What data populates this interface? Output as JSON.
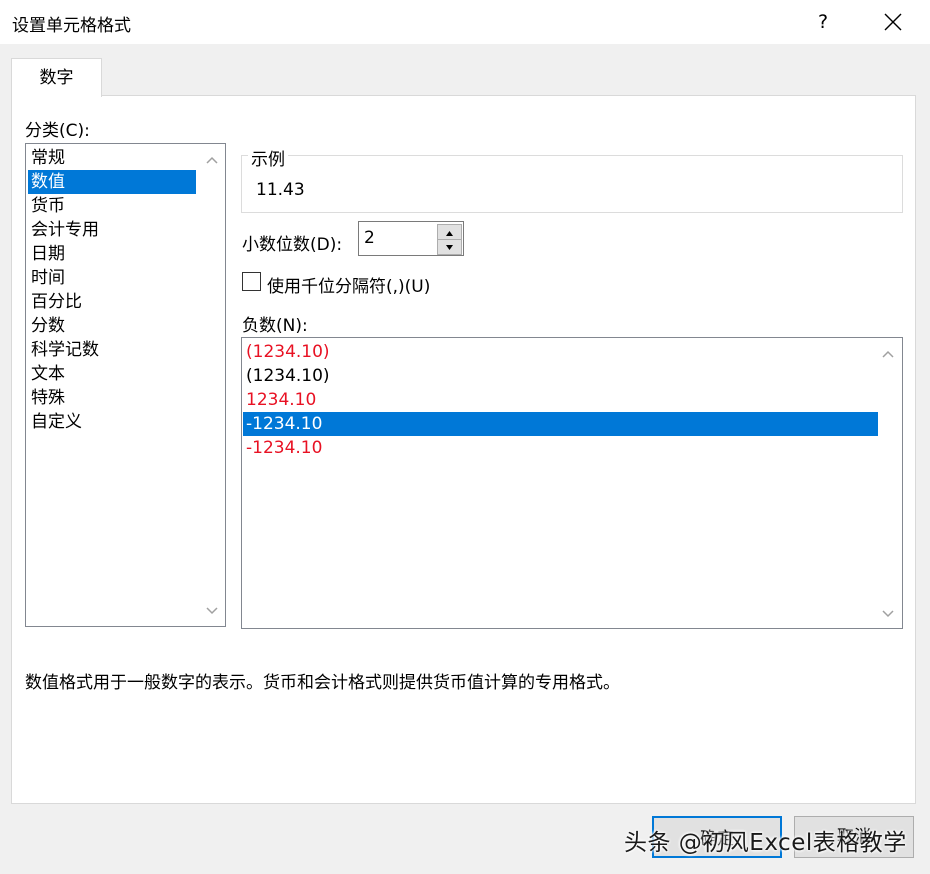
{
  "window": {
    "title": "设置单元格格式",
    "help_label": "?"
  },
  "tabs": [
    {
      "label": "数字",
      "active": true
    }
  ],
  "category": {
    "label": "分类(C):",
    "items": [
      "常规",
      "数值",
      "货币",
      "会计专用",
      "日期",
      "时间",
      "百分比",
      "分数",
      "科学记数",
      "文本",
      "特殊",
      "自定义"
    ],
    "selected": "数值"
  },
  "sample": {
    "legend": "示例",
    "value": "11.43"
  },
  "decimal_places": {
    "label": "小数位数(D):",
    "value": "2"
  },
  "thousands_separator": {
    "label": "使用千位分隔符(,)(U)",
    "checked": false
  },
  "negative_numbers": {
    "label": "负数(N):",
    "items": [
      {
        "text": "(1234.10)",
        "color": "#e81123"
      },
      {
        "text": "(1234.10)",
        "color": "#000000"
      },
      {
        "text": "1234.10",
        "color": "#e81123"
      },
      {
        "text": "-1234.10",
        "color": "#000000",
        "selected": true
      },
      {
        "text": "-1234.10",
        "color": "#e81123"
      }
    ]
  },
  "description": "数值格式用于一般数字的表示。货币和会计格式则提供货币值计算的专用格式。",
  "buttons": {
    "ok": "确定",
    "cancel": "取消"
  },
  "watermark": "头条 @初风Excel表格教学",
  "colors": {
    "accent": "#0078d7",
    "negative_red": "#e81123",
    "dialog_bg": "#f0f0f0"
  }
}
